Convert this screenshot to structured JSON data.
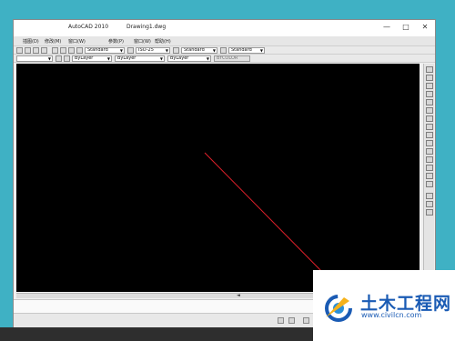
{
  "app": {
    "title": "AutoCAD 2010",
    "document": "Drawing1.dwg"
  },
  "window_controls": {
    "minimize": "—",
    "maximize": "□",
    "close": "✕"
  },
  "menu": {
    "items": [
      "插图(D)",
      "修改(M)",
      "窗口(W)",
      "参数(P)",
      "窗口(W)",
      "帮助(H)"
    ]
  },
  "toolbar_styles": {
    "text_style": "Standard",
    "dim_style": "ISO-25",
    "table_style": "Standard",
    "multileader_style": "Standard"
  },
  "properties_bar": {
    "layer": "ByLayer",
    "linetype": "ByLayer",
    "lineweight": "ByLayer",
    "plot_style": "BYCOLOR"
  },
  "canvas": {
    "background": "#000000",
    "line_color": "#e0202a"
  },
  "watermark": {
    "title": "土木工程网",
    "url": "www.civilcn.com",
    "brand_color": "#1a5bb4"
  }
}
